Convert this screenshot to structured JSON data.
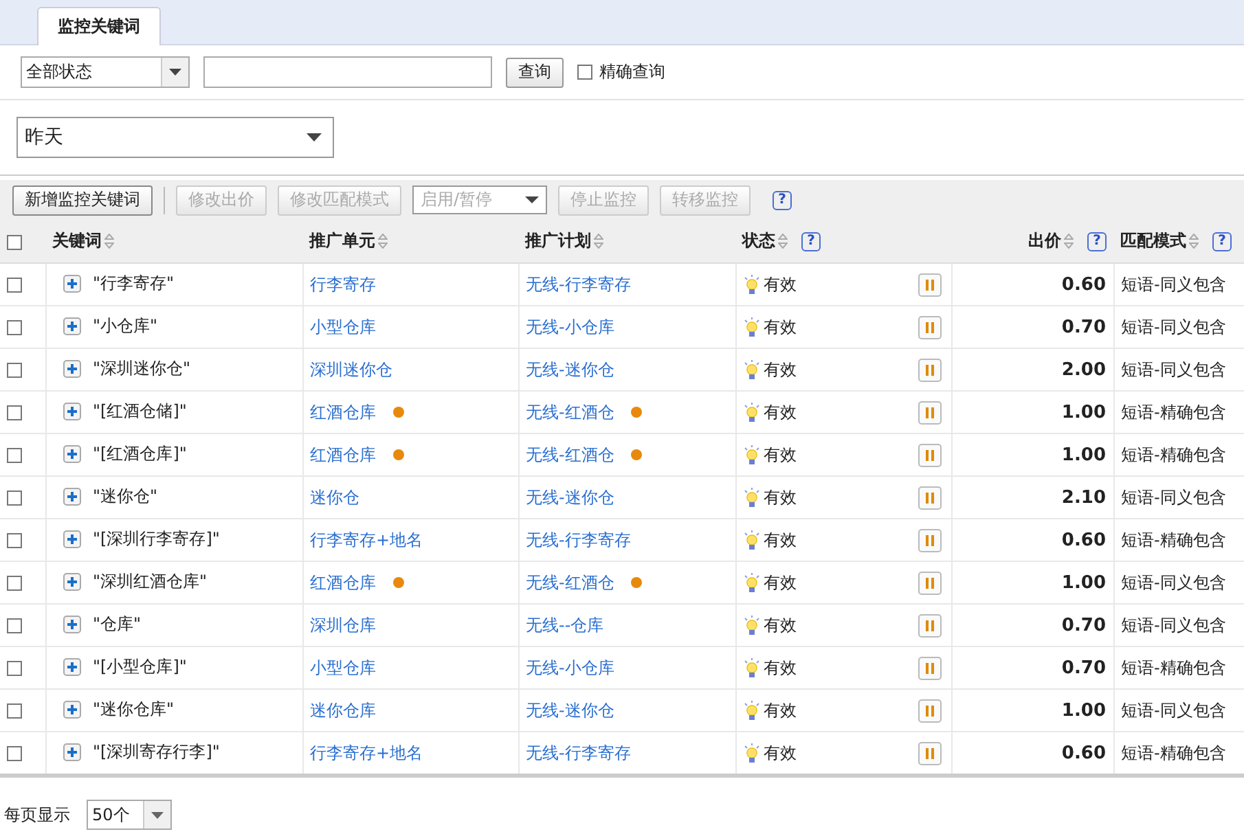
{
  "tabs": [
    {
      "label": "监控关键词",
      "selected": true
    }
  ],
  "filter": {
    "status_select": "全部状态",
    "search_button": "查询",
    "exact_checkbox": {
      "label": "精确查询",
      "checked": false
    }
  },
  "date_select": "昨天",
  "toolbar": [
    {
      "kind": "button",
      "label": "新增监控关键词",
      "disabled": false
    },
    {
      "kind": "button",
      "label": "修改出价",
      "disabled": true
    },
    {
      "kind": "button",
      "label": "修改匹配模式",
      "disabled": true
    },
    {
      "kind": "select",
      "label": "启用/暂停",
      "disabled": true
    },
    {
      "kind": "button",
      "label": "停止监控",
      "disabled": true
    },
    {
      "kind": "button",
      "label": "转移监控",
      "disabled": true
    },
    {
      "kind": "help",
      "label": "?"
    }
  ],
  "table": {
    "all_checked": false,
    "columns": [
      {
        "label": "关键词"
      },
      {
        "label": "推广单元"
      },
      {
        "label": "推广计划"
      },
      {
        "label": "状态",
        "help": "?"
      },
      {
        "label": "出价",
        "help": "?"
      },
      {
        "label": "匹配模式",
        "help": "?"
      }
    ],
    "rows": [
      {
        "checked": false,
        "keyword": "\"行李寄存\"",
        "unit": "行李寄存",
        "unit_flag": false,
        "plan": "无线-行李寄存",
        "plan_flag": false,
        "status": "有效",
        "price": "0.60",
        "match": "短语-同义包含"
      },
      {
        "checked": false,
        "keyword": "\"小仓库\"",
        "unit": "小型仓库",
        "unit_flag": false,
        "plan": "无线-小仓库",
        "plan_flag": false,
        "status": "有效",
        "price": "0.70",
        "match": "短语-同义包含"
      },
      {
        "checked": false,
        "keyword": "\"深圳迷你仓\"",
        "unit": "深圳迷你仓",
        "unit_flag": false,
        "plan": "无线-迷你仓",
        "plan_flag": false,
        "status": "有效",
        "price": "2.00",
        "match": "短语-同义包含"
      },
      {
        "checked": false,
        "keyword": "\"[红酒仓储]\"",
        "unit": "红酒仓库",
        "unit_flag": true,
        "plan": "无线-红酒仓",
        "plan_flag": true,
        "status": "有效",
        "price": "1.00",
        "match": "短语-精确包含"
      },
      {
        "checked": false,
        "keyword": "\"[红酒仓库]\"",
        "unit": "红酒仓库",
        "unit_flag": true,
        "plan": "无线-红酒仓",
        "plan_flag": true,
        "status": "有效",
        "price": "1.00",
        "match": "短语-精确包含"
      },
      {
        "checked": false,
        "keyword": "\"迷你仓\"",
        "unit": "迷你仓",
        "unit_flag": false,
        "plan": "无线-迷你仓",
        "plan_flag": false,
        "status": "有效",
        "price": "2.10",
        "match": "短语-同义包含"
      },
      {
        "checked": false,
        "keyword": "\"[深圳行李寄存]\"",
        "unit": "行李寄存+地名",
        "unit_flag": false,
        "plan": "无线-行李寄存",
        "plan_flag": false,
        "status": "有效",
        "price": "0.60",
        "match": "短语-精确包含"
      },
      {
        "checked": false,
        "keyword": "\"深圳红酒仓库\"",
        "unit": "红酒仓库",
        "unit_flag": true,
        "plan": "无线-红酒仓",
        "plan_flag": true,
        "status": "有效",
        "price": "1.00",
        "match": "短语-同义包含"
      },
      {
        "checked": false,
        "keyword": "\"仓库\"",
        "unit": "深圳仓库",
        "unit_flag": false,
        "plan": "无线--仓库",
        "plan_flag": false,
        "status": "有效",
        "price": "0.70",
        "match": "短语-同义包含"
      },
      {
        "checked": false,
        "keyword": "\"[小型仓库]\"",
        "unit": "小型仓库",
        "unit_flag": false,
        "plan": "无线-小仓库",
        "plan_flag": false,
        "status": "有效",
        "price": "0.70",
        "match": "短语-精确包含"
      },
      {
        "checked": false,
        "keyword": "\"迷你仓库\"",
        "unit": "迷你仓库",
        "unit_flag": false,
        "plan": "无线-迷你仓",
        "plan_flag": false,
        "status": "有效",
        "price": "1.00",
        "match": "短语-同义包含"
      },
      {
        "checked": false,
        "keyword": "\"[深圳寄存行李]\"",
        "unit": "行李寄存+地名",
        "unit_flag": false,
        "plan": "无线-行李寄存",
        "plan_flag": false,
        "status": "有效",
        "price": "0.60",
        "match": "短语-精确包含"
      }
    ]
  },
  "pager": {
    "label": "每页显示",
    "page_size": "50个"
  }
}
